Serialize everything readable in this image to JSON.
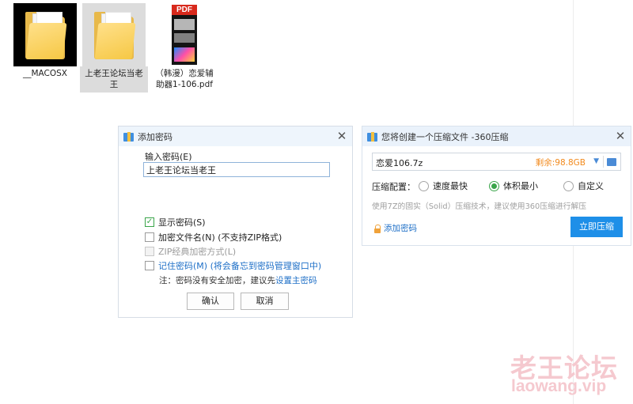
{
  "desktop": {
    "files": [
      {
        "name": "__MACOSX",
        "type": "folder"
      },
      {
        "name": "上老王论坛当老王",
        "type": "folder",
        "selected": true
      },
      {
        "name": "（韩漫）恋爱辅助器1-106.pdf",
        "type": "pdf"
      }
    ],
    "pdf_badge": "PDF"
  },
  "password_dialog": {
    "title": "添加密码",
    "input_label": "输入密码(E)",
    "password_value": "上老王论坛当老王",
    "options": [
      {
        "label": "显示密码(S)",
        "checked": true,
        "enabled": true
      },
      {
        "label": "加密文件名(N) (不支持ZIP格式)",
        "checked": false,
        "enabled": true
      },
      {
        "label": "ZIP经典加密方式(L)",
        "checked": false,
        "enabled": false
      },
      {
        "label": "记住密码(M) (将会备忘到密码管理窗口中)",
        "checked": false,
        "enabled": true
      }
    ],
    "note_prefix": "注：密码没有安全加密，建议先",
    "note_link": "设置主密码",
    "ok_label": "确认",
    "cancel_label": "取消"
  },
  "compress_dialog": {
    "title": "您将创建一个压缩文件 -360压缩",
    "filename": "恋爱106.7z",
    "remaining_space": "剩余:98.8GB",
    "config_label": "压缩配置：",
    "modes": [
      {
        "label": "速度最快",
        "selected": false
      },
      {
        "label": "体积最小",
        "selected": true
      },
      {
        "label": "自定义",
        "selected": false
      }
    ],
    "hint": "使用7Z的固实（Solid）压缩技术，建议使用360压缩进行解压",
    "add_password_label": "添加密码",
    "compress_label": "立即压缩"
  },
  "watermark": {
    "cn": "老王论坛",
    "en": "laowang.vip"
  },
  "colors": {
    "accent": "#1e8fe8",
    "check_green": "#3aa54a",
    "space_orange": "#f28a1d",
    "link_blue": "#1e6fc7"
  }
}
